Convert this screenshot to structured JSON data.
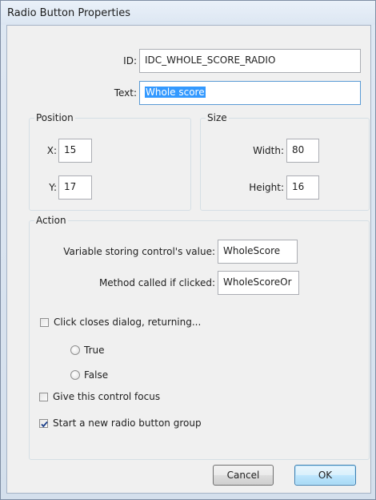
{
  "window": {
    "title": "Radio Button Properties"
  },
  "fields": {
    "id_label": "ID:",
    "id_value": "IDC_WHOLE_SCORE_RADIO",
    "text_label": "Text:",
    "text_value": "Whole score"
  },
  "position": {
    "title": "Position",
    "x_label": "X:",
    "x_value": "15",
    "y_label": "Y:",
    "y_value": "17"
  },
  "size": {
    "title": "Size",
    "width_label": "Width:",
    "width_value": "80",
    "height_label": "Height:",
    "height_value": "16"
  },
  "action": {
    "title": "Action",
    "variable_label": "Variable storing control's value:",
    "variable_value": "WholeScore",
    "method_label": "Method called if clicked:",
    "method_value": "WholeScoreOr",
    "closes_label": "Click closes dialog, returning...",
    "closes_checked": false,
    "true_label": "True",
    "false_label": "False"
  },
  "options": {
    "focus_label": "Give this control focus",
    "focus_checked": false,
    "group_label": "Start a new radio button group",
    "group_checked": true
  },
  "buttons": {
    "cancel": "Cancel",
    "ok": "OK"
  }
}
